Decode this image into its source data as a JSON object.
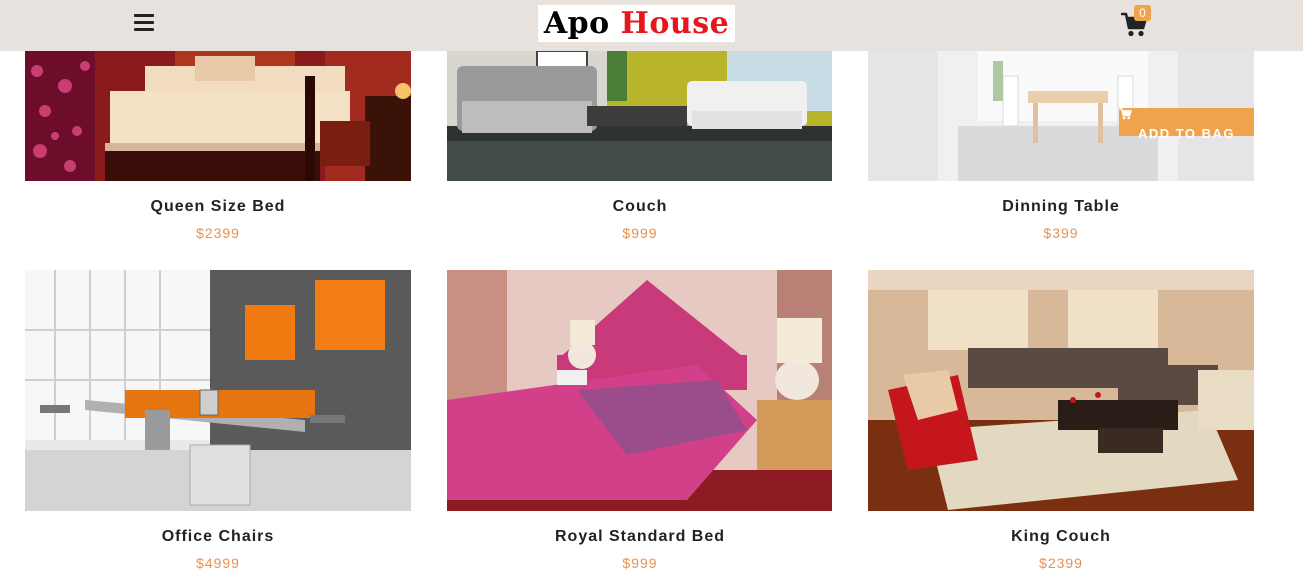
{
  "header": {
    "logo_word1": "Apo",
    "logo_word2": "House",
    "cart_count": "0"
  },
  "products": [
    {
      "name": "Queen Size Bed",
      "price": "$2399"
    },
    {
      "name": "Couch",
      "price": "$999"
    },
    {
      "name": "Dinning Table",
      "price": "$399",
      "button": "ADD TO BAG"
    },
    {
      "name": "Office Chairs",
      "price": "$4999"
    },
    {
      "name": "Royal Standard Bed",
      "price": "$999"
    },
    {
      "name": "King Couch",
      "price": "$2399"
    }
  ],
  "colors": {
    "navbar_bg": "#e7e2dd",
    "accent": "#f0a24c",
    "price": "#ea9150",
    "logo_red": "#e8151d"
  }
}
